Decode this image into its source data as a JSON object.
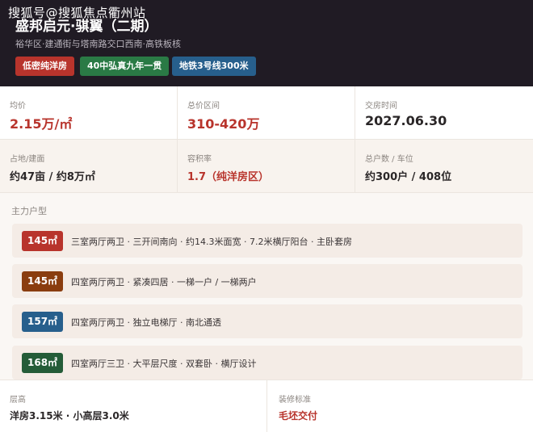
{
  "header": {
    "watermark": "搜狐号@搜狐焦点衢州站",
    "title": "盛邦启元·骐翼（二期）",
    "subtitle": "裕华区·建通街与塔南路交口西南·高铁板核",
    "tags": [
      "低密纯洋房",
      "40中弘真九年一贯",
      "地铁3号线300米"
    ],
    "tag_colors": [
      "#b8342c",
      "#2a7a45",
      "#275f8c"
    ]
  },
  "stats": [
    {
      "label": "均价",
      "value": "2.15万/㎡"
    },
    {
      "label": "总价区间",
      "value": "310-420万"
    },
    {
      "label": "交房时间",
      "value": "2027.06.30"
    },
    {
      "label": "占地/建面",
      "value": "约47亩 / 约8万㎡"
    },
    {
      "label": "容积率",
      "value": "1.7（纯洋房区）"
    },
    {
      "label": "总户数 / 车位",
      "value": "约300户 / 408位"
    }
  ],
  "units_section": {
    "title": "主力户型",
    "items": [
      {
        "size": "145㎡",
        "desc": "三室两厅两卫 · 三开间南向 · 约14.3米面宽 · 7.2米横厅阳台 · 主卧套房",
        "color": "#b8342c"
      },
      {
        "size": "145㎡",
        "desc": "四室两厅两卫 · 紧凑四居 · 一梯一户 / 一梯两户",
        "color": "#8a3d0f"
      },
      {
        "size": "157㎡",
        "desc": "四室两厅两卫 · 独立电梯厅 · 南北通透",
        "color": "#275f8c"
      },
      {
        "size": "168㎡",
        "desc": "四室两厅三卫 · 大平层尺度 · 双套卧 · 横厅设计",
        "color": "#245c38"
      }
    ]
  },
  "bottom": [
    {
      "label": "层高",
      "value": "洋房3.15米 · 小高层3.0米"
    },
    {
      "label": "装修标准",
      "value": "毛坯交付"
    }
  ],
  "colors": {
    "accent_red": "#b8342c",
    "header_bg": "#201b24"
  }
}
